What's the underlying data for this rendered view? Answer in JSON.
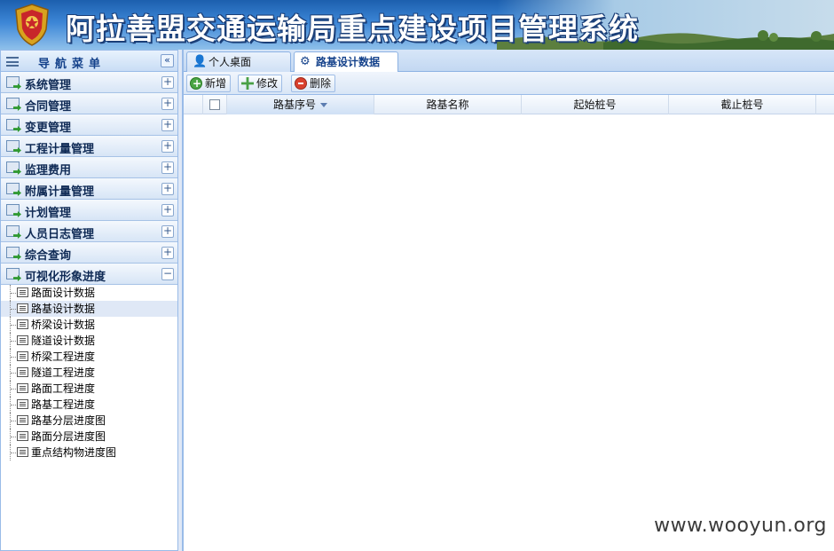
{
  "header": {
    "title": "阿拉善盟交通运输局重点建设项目管理系统",
    "emblem_icon": "police-emblem-icon"
  },
  "nav": {
    "title": "导航菜单",
    "groups": [
      {
        "label": "系统管理",
        "toggle": "+"
      },
      {
        "label": "合同管理",
        "toggle": "+"
      },
      {
        "label": "变更管理",
        "toggle": "+"
      },
      {
        "label": "工程计量管理",
        "toggle": "+"
      },
      {
        "label": "监理费用",
        "toggle": "+"
      },
      {
        "label": "附属计量管理",
        "toggle": "+"
      },
      {
        "label": "计划管理",
        "toggle": "+"
      },
      {
        "label": "人员日志管理",
        "toggle": "+"
      },
      {
        "label": "综合查询",
        "toggle": "+"
      },
      {
        "label": "可视化形象进度",
        "toggle": "−"
      }
    ],
    "sub_items": [
      "路面设计数据",
      "路基设计数据",
      "桥梁设计数据",
      "隧道设计数据",
      "桥梁工程进度",
      "隧道工程进度",
      "路面工程进度",
      "路基工程进度",
      "路基分层进度图",
      "路面分层进度图",
      "重点结构物进度图"
    ],
    "selected_sub": "路基设计数据"
  },
  "tabs": [
    {
      "label": "个人桌面",
      "icon": "user-icon"
    },
    {
      "label": "路基设计数据",
      "icon": "gear-icon",
      "active": true
    }
  ],
  "toolbar": {
    "add_label": "新增",
    "edit_label": "修改",
    "delete_label": "删除"
  },
  "grid": {
    "columns": [
      "路基序号",
      "路基名称",
      "起始桩号",
      "截止桩号"
    ],
    "sorted_column": "路基序号",
    "rows": []
  },
  "watermark": "www.wooyun.org",
  "colors": {
    "banner_blue": "#1c5fae",
    "panel_border": "#99bbe8",
    "selected_row": "#dfe8f6",
    "nav_text": "#15428b"
  }
}
